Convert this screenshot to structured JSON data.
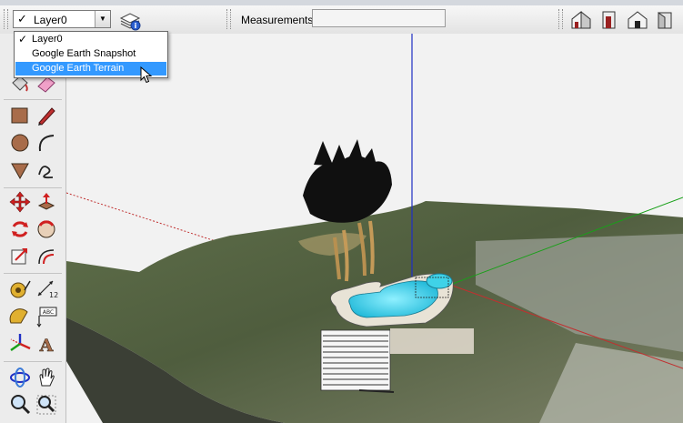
{
  "layer_toolbar": {
    "current_layer": "Layer0",
    "layers": [
      {
        "label": "Layer0",
        "checked": true
      },
      {
        "label": "Google Earth Snapshot",
        "checked": false
      },
      {
        "label": "Google Earth Terrain",
        "checked": false,
        "highlighted": true
      }
    ]
  },
  "measurements": {
    "label": "Measurements",
    "value": ""
  },
  "view_buttons": [
    "iso-view-icon",
    "front-view-icon",
    "back-view-icon",
    "left-view-icon"
  ],
  "tools": [
    "paint-bucket-icon",
    "eraser-icon",
    "rectangle-icon",
    "pencil-icon",
    "circle-icon",
    "arc-icon",
    "polygon-icon",
    "freehand-icon",
    "move-icon",
    "push-pull-icon",
    "rotate-icon",
    "follow-me-icon",
    "scale-icon",
    "offset-icon",
    "tape-measure-icon",
    "dimension-icon",
    "protractor-icon",
    "text-icon",
    "axes-icon",
    "3d-text-icon",
    "orbit-icon",
    "pan-icon",
    "zoom-icon",
    "zoom-window-icon"
  ],
  "colors": {
    "selection": "#3399ff",
    "blue_axis": "#1f2fc4",
    "green_axis": "#19a019",
    "red_axis": "#c03030",
    "pool": "#3fd2e8"
  }
}
